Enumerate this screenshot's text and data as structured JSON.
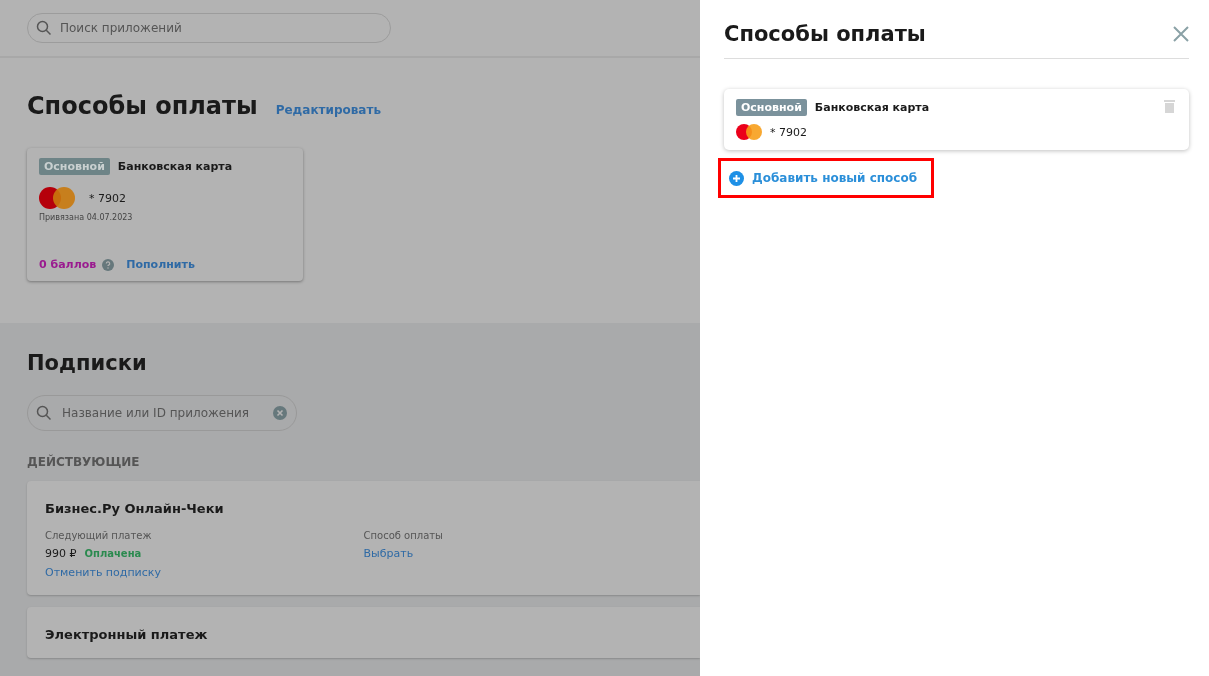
{
  "header": {
    "search": {
      "placeholder": "Поиск приложений"
    }
  },
  "payment_methods": {
    "title": "Способы оплаты",
    "edit_link": "Редактировать",
    "cards": [
      {
        "badge": "Основной",
        "name": "Банковская карта",
        "number": "* 7902",
        "linked": "Привязана 04.07.2023",
        "points": "0 баллов",
        "topup_link": "Пополнить"
      }
    ]
  },
  "subscriptions": {
    "title": "Подписки",
    "search": {
      "placeholder": "Название или ID приложения"
    },
    "group_label": "ДЕЙСТВУЮЩИЕ",
    "items": [
      {
        "name": "Бизнес.Ру Онлайн-Чеки",
        "next_label": "Следующий платеж",
        "price": "990 ₽",
        "status": "Оплачена",
        "cancel_link": "Отменить подписку",
        "method_label": "Способ оплаты",
        "method_link": "Выбрать"
      },
      {
        "name": "Электронный платеж"
      }
    ]
  },
  "drawer": {
    "title": "Способы оплаты",
    "methods": [
      {
        "badge": "Основной",
        "name": "Банковская карта",
        "number": "* 7902"
      }
    ],
    "add_link": {
      "label": "Добавить новый способ",
      "highlighted": true
    }
  }
}
